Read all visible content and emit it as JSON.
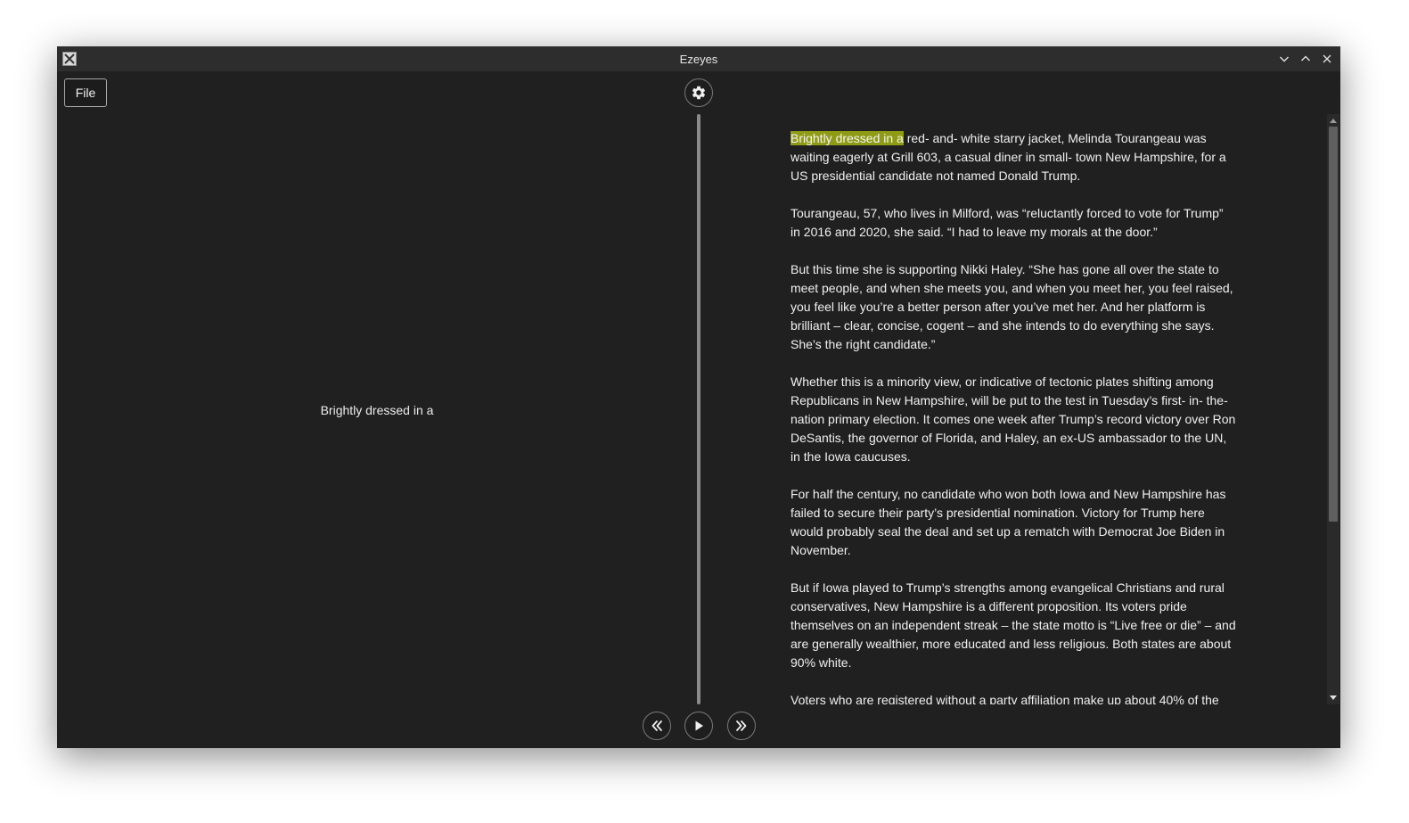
{
  "window": {
    "title": "Ezeyes"
  },
  "toolbar": {
    "file_label": "File"
  },
  "icons": {
    "app": "x11-app-icon",
    "settings": "gear-icon",
    "minimize": "chevron-down-icon",
    "maximize": "chevron-up-icon",
    "close": "close-icon",
    "rewind": "double-chevron-left-icon",
    "play": "play-icon",
    "forward": "double-chevron-right-icon"
  },
  "colors": {
    "background": "#202020",
    "titlebar": "#2d2d2d",
    "highlight": "#8f9b14",
    "text": "#f0f0f0"
  },
  "reader": {
    "current_chunk": "Brightly dressed in a"
  },
  "article": {
    "highlighted": "Brightly dressed in a",
    "paragraphs": [
      " red- and- white starry jacket, Melinda Tourangeau was waiting eagerly at Grill 603, a casual diner in small- town New Hampshire, for a US presidential candidate not named Donald Trump.",
      "Tourangeau, 57, who lives in Milford, was “reluctantly forced to vote for Trump” in 2016 and 2020, she said. “I had to leave my morals at the door.”",
      "But this time she is supporting Nikki Haley. “She has gone all over the state to meet people, and when she meets you, and when you meet her, you feel raised, you feel like you’re a better person after you’ve met her. And her platform is brilliant – clear, concise, cogent – and she intends to do everything she says. She’s the right candidate.”",
      "Whether this is a minority view, or indicative of tectonic plates shifting among Republicans in New Hampshire, will be put to the test in Tuesday’s first- in- the- nation primary election. It comes one week after Trump’s record victory over Ron DeSantis, the governor of Florida, and Haley, an ex-US ambassador to the UN, in the Iowa caucuses.",
      "For half the century, no candidate who won both Iowa and New Hampshire has failed to secure their party’s presidential nomination. Victory for Trump here would probably seal the deal and set up a rematch with Democrat Joe Biden in November.",
      "But if Iowa played to Trump’s strengths among evangelical Christians and rural conservatives, New Hampshire is a different proposition. Its voters pride themselves on an independent streak – the state motto is “Live free or die” – and are generally wealthier, more educated and less religious. Both states are about 90% white.",
      "Voters who are registered without a party affiliation make up about 40% of the"
    ]
  }
}
